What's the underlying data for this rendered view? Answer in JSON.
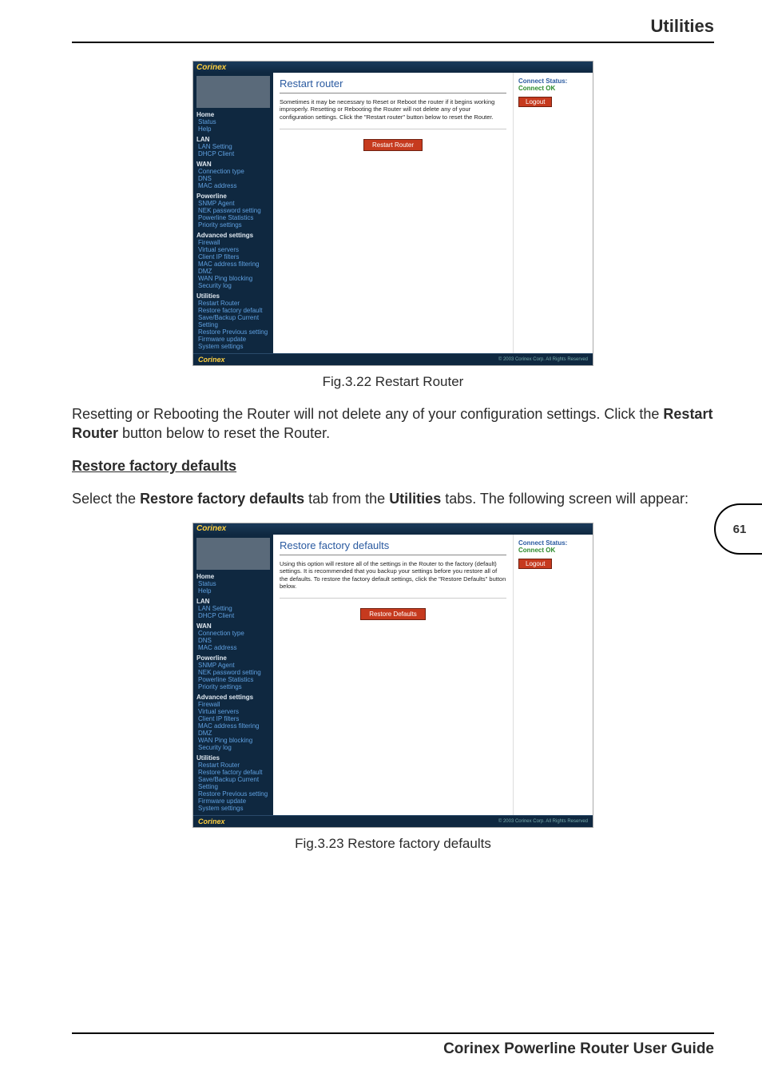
{
  "header": {
    "title": "Utilities"
  },
  "page_number": "61",
  "footer": {
    "text": "Corinex Powerline Router User Guide"
  },
  "fig1": {
    "caption": "Fig.3.22 Restart Router",
    "brand": "Corinex",
    "main_heading": "Restart router",
    "main_text": "Sometimes it may be necessary to Reset or Reboot the router if it begins working improperly. Resetting or Rebooting the Router will not delete any of your configuration settings. Click the \"Restart router\" button below to reset the Router.",
    "button": "Restart Router",
    "status_label": "Connect Status:",
    "status_value": "Connect OK",
    "logout": "Logout",
    "copy": "© 2003 Corinex Corp. All Rights Reserved",
    "nav": {
      "home": "Home",
      "status": "Status",
      "help": "Help",
      "lan": "LAN",
      "lan_setting": "LAN Setting",
      "dhcp_client": "DHCP Client",
      "wan": "WAN",
      "conn_type": "Connection type",
      "dns": "DNS",
      "mac_addr": "MAC address",
      "powerline": "Powerline",
      "snmp": "SNMP Agent",
      "nek": "NEK password setting",
      "pl_stats": "Powerline Statistics",
      "pri": "Priority settings",
      "adv": "Advanced settings",
      "firewall": "Firewall",
      "vservers": "Virtual servers",
      "cip": "Client IP filters",
      "macfilter": "MAC address filtering",
      "dmz": "DMZ",
      "wanping": "WAN Ping blocking",
      "seclog": "Security log",
      "utilities": "Utilities",
      "restart": "Restart Router",
      "restore_def": "Restore factory default",
      "save_cur": "Save/Backup Current Setting",
      "restore_prev": "Restore Previous setting",
      "fw": "Firmware update",
      "sys": "System settings"
    }
  },
  "para1_a": "Resetting or Rebooting the Router will not delete any of your configuration settings. Click the ",
  "para1_b": "Restart Router",
  "para1_c": " button below to reset the Router.",
  "section_heading": "Restore factory defaults",
  "para2_a": "Select the ",
  "para2_b": "Restore factory defaults",
  "para2_c": " tab from the ",
  "para2_d": "Utilities",
  "para2_e": " tabs. The following screen will appear:",
  "fig2": {
    "caption": "Fig.3.23 Restore factory defaults",
    "brand": "Corinex",
    "main_heading": "Restore factory defaults",
    "main_text": "Using this option will restore all of the settings in the Router to the factory (default) settings. It is recommended that you backup your settings before you restore all of the defaults. To restore the factory default settings, click the \"Restore Defaults\" button below.",
    "button": "Restore Defaults",
    "status_label": "Connect Status:",
    "status_value": "Connect OK",
    "logout": "Logout",
    "copy": "© 2003 Corinex Corp. All Rights Reserved"
  }
}
